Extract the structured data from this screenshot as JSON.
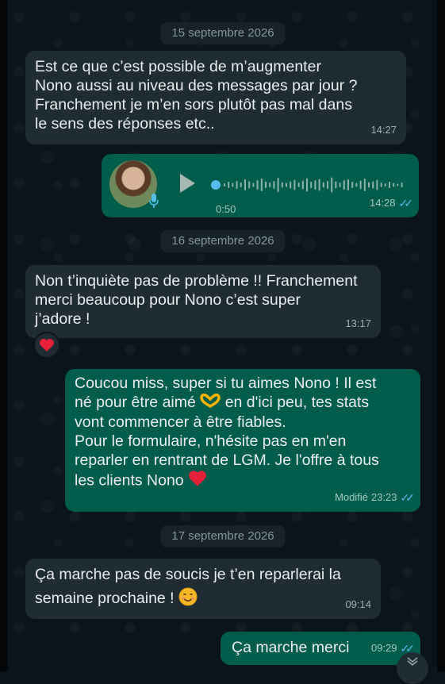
{
  "dates": {
    "d1": "15 septembre 2026",
    "d2": "16 septembre 2026",
    "d3": "17 septembre 2026"
  },
  "messages": {
    "m1": {
      "lines": [
        "Est ce que c’est possible de m’augmenter",
        "Nono aussi au niveau des messages par jour ?",
        "Franchement je m’en sors plutôt pas mal dans",
        "le sens des réponses etc.."
      ],
      "time": "14:27"
    },
    "voice": {
      "duration": "0:50",
      "time": "14:28"
    },
    "m2": {
      "lines": [
        "Non t’inquiète pas de problème !! Franchement",
        "merci beaucoup pour Nono c’est super",
        "j’adore !"
      ],
      "time": "13:17",
      "reaction": "heart"
    },
    "m3": {
      "lines": [
        "Coucou miss, super si tu aimes Nono ! Il est",
        "né pour être aimé",
        "en d'ici peu, tes stats",
        "vont commencer à être fiables.",
        "Pour le formulaire, n'hésite pas en m'en",
        "reparler en rentrant de LGM. Je l'offre à tous",
        "les clients Nono"
      ],
      "edited": "Modifié",
      "time": "23:23"
    },
    "m4": {
      "lines": [
        "Ça marche pas de soucis je t’en reparlerai la",
        "semaine prochaine !"
      ],
      "time": "09:14"
    },
    "m5": {
      "text": "Ça marche merci",
      "time": "09:29"
    }
  },
  "colors": {
    "incoming": "#202c33",
    "outgoing": "#005c4b",
    "read_ticks": "#53bdeb",
    "voice_accent": "#53bdeb"
  }
}
